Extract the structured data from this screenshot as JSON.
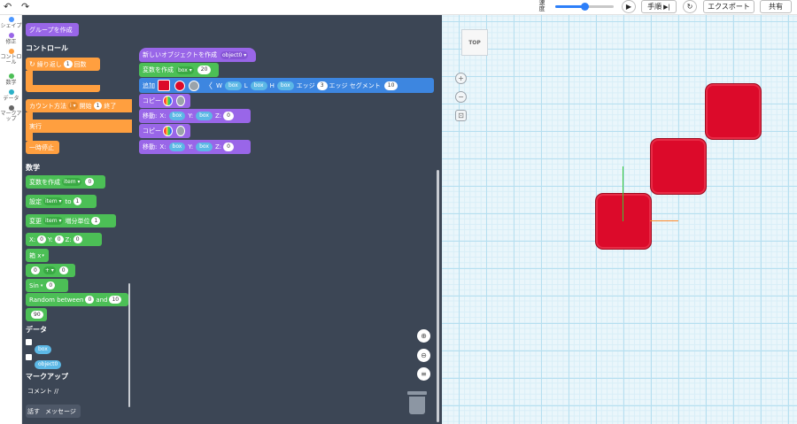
{
  "topbar": {
    "undo_icon": "↶",
    "redo_icon": "↷",
    "speed_label": "速度",
    "speed_level": 0.5,
    "play_icon": "▶",
    "step_label": "手順",
    "step_icon": "▶|",
    "reset_icon": "↻",
    "export_label": "エクスポート",
    "share_label": "共有"
  },
  "categories": [
    {
      "label": "シェイプ",
      "color": "#4c97ff"
    },
    {
      "label": "修正",
      "color": "#9966e8"
    },
    {
      "label": "コントロール",
      "color": "#ff9f3f"
    },
    {
      "label": "数学",
      "color": "#4cbf56"
    },
    {
      "label": "データ",
      "color": "#2ab0c7"
    },
    {
      "label": "マークアップ",
      "color": "#666666"
    }
  ],
  "palette": {
    "group_create": "グループを作成",
    "control_title": "コントロール",
    "repeat": {
      "label": "繰り返し",
      "count": "1",
      "unit": "回数"
    },
    "count_loop": {
      "label": "カウント方法",
      "var": "i",
      "start_label": "開始",
      "start": "1",
      "end_label": "終了"
    },
    "execute": "実行",
    "pause": "一時停止",
    "math_title": "数学",
    "create_var": {
      "label": "変数を作成",
      "var": "item",
      "value": "0"
    },
    "set_var": {
      "label": "設定",
      "var": "item",
      "to": "to",
      "value": "1"
    },
    "change_var": {
      "label": "変更",
      "var": "item",
      "step_label": "増分単位",
      "value": "1"
    },
    "xyz": {
      "x_label": "X:",
      "x": "0",
      "y_label": "Y:",
      "y": "0",
      "z_label": "Z:",
      "z": "0"
    },
    "vec_x": "箱 x",
    "op": {
      "a": "0",
      "op": "+",
      "b": "0"
    },
    "sin": {
      "label": "Sin",
      "value": "0"
    },
    "random": {
      "label": "Random between",
      "a": "0",
      "and": "and",
      "b": "10"
    },
    "num90": "90",
    "data_title": "データ",
    "data_vars": [
      "box",
      "object0"
    ],
    "markup_title": "マークアップ",
    "comment": "コメント //",
    "say_label": "話す",
    "say_message": "メッセージ"
  },
  "workspace": {
    "new_object": {
      "label": "新しいオブジェクトを作成",
      "name": "object0"
    },
    "create_var": {
      "label": "変数を作成",
      "var": "box",
      "value": "20"
    },
    "add": {
      "label": "追加",
      "w_label": "W",
      "w": "box",
      "l_label": "L",
      "l": "box",
      "h_label": "H",
      "h": "box",
      "edge_label": "エッジ",
      "edge": "3",
      "seg_label": "エッジ セグメント",
      "seg": "10",
      "color": "#dc0a2a"
    },
    "copy_label": "コピー",
    "move": {
      "label": "移動:",
      "x_label": "X:",
      "x": "box",
      "y_label": "Y:",
      "y": "box",
      "z_label": "Z:",
      "z": "0"
    },
    "zoom_in_icon": "⊕",
    "zoom_out_icon": "⊖",
    "fit_icon": "≡"
  },
  "viewport": {
    "viewcube_label": "TOP",
    "plus_icon": "+",
    "minus_icon": "−",
    "fit_icon": "⊡"
  }
}
